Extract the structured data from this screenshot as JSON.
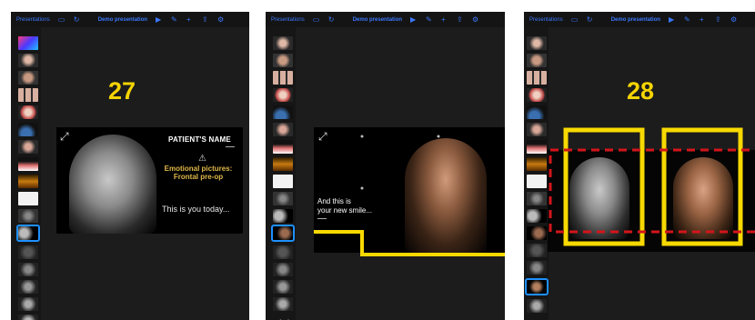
{
  "topbar": {
    "app_label": "Presentations",
    "title": "Demo presentation"
  },
  "panels": [
    {
      "slide_number": "27",
      "slide": {
        "title": "PATIENT'S NAME",
        "warning_label": "Emotional pictures: Frontal pre-op",
        "caption": "This is you today..."
      }
    },
    {
      "slide_number": "",
      "slide": {
        "caption_line1": "And this is",
        "caption_line2": "your new smile..."
      }
    },
    {
      "slide_number": "28"
    }
  ],
  "colors": {
    "annotation_yellow": "#f7d900",
    "annotation_red": "#d3151b",
    "selection_blue": "#1e90ff",
    "toolbar_blue": "#3b78ff"
  },
  "icons": [
    "expand-icon",
    "warning-icon",
    "play-icon",
    "edit-icon",
    "add-icon",
    "share-icon",
    "settings-icon",
    "chevron-left-icon",
    "chevron-right-icon"
  ]
}
